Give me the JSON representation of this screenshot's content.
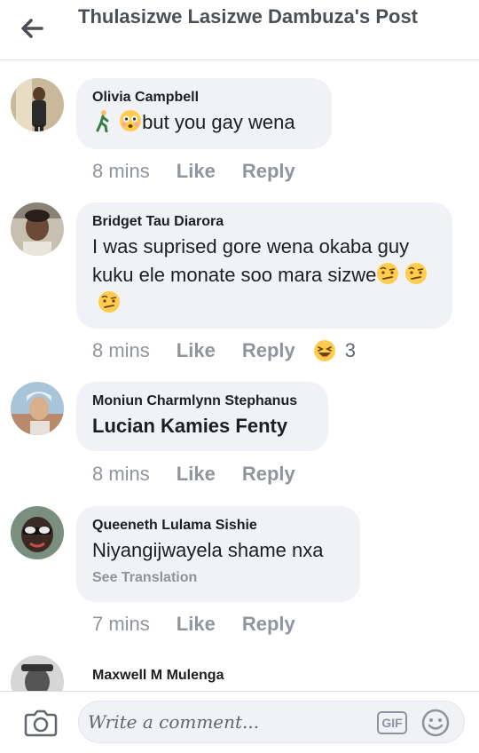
{
  "header": {
    "title": "Thulasizwe Lasizwe Dambuza's Post"
  },
  "comments": [
    {
      "author": "Olivia Campbell",
      "text": "but you gay wena",
      "time": "8 mins",
      "like": "Like",
      "reply": "Reply"
    },
    {
      "author": "Bridget Tau Diarora",
      "text": "I was suprised gore wena okaba guy kuku ele monate soo mara sizwe",
      "time": "8 mins",
      "like": "Like",
      "reply": "Reply",
      "reaction_count": "3"
    },
    {
      "author": "Moniun Charmlynn Stephanus",
      "text": "Lucian Kamies Fenty",
      "time": "8 mins",
      "like": "Like",
      "reply": "Reply"
    },
    {
      "author": "Queeneth Lulama Sishie",
      "text": "Niyangijwayela shame nxa",
      "see_translation": "See Translation",
      "time": "7 mins",
      "like": "Like",
      "reply": "Reply"
    },
    {
      "author": "Maxwell M Mulenga"
    }
  ],
  "composer": {
    "placeholder": "Write a comment...",
    "gif": "GIF"
  }
}
